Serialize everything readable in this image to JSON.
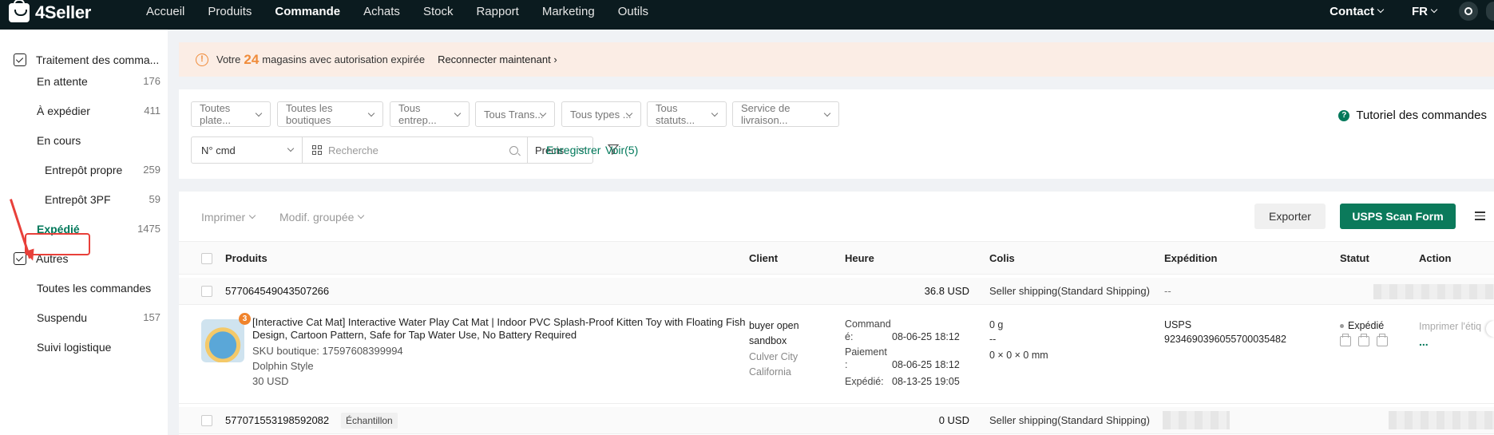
{
  "brand": {
    "name": "4Seller"
  },
  "nav": {
    "items": [
      "Accueil",
      "Produits",
      "Commande",
      "Achats",
      "Stock",
      "Rapport",
      "Marketing",
      "Outils"
    ],
    "active": "Commande",
    "contact": "Contact",
    "lang": "FR"
  },
  "sidebar": {
    "group1": "Traitement des comma...",
    "pending": {
      "label": "En attente",
      "count": "176"
    },
    "to_ship": {
      "label": "À expédier",
      "count": "411"
    },
    "in_progress": {
      "label": "En cours"
    },
    "own_wh": {
      "label": "Entrepôt propre",
      "count": "259"
    },
    "wh_3pf": {
      "label": "Entrepôt 3PF",
      "count": "59"
    },
    "shipped": {
      "label": "Expédié",
      "count": "1475"
    },
    "group2": "Autres",
    "all_orders": {
      "label": "Toutes les commandes"
    },
    "suspended": {
      "label": "Suspendu",
      "count": "157"
    },
    "tracking": {
      "label": "Suivi logistique"
    }
  },
  "alert": {
    "prefix": "Votre",
    "count": "24",
    "suffix": "magasins avec autorisation expirée",
    "action": "Reconnecter maintenant"
  },
  "filters": {
    "platforms": "Toutes plate...",
    "shops": "Toutes les boutiques",
    "warehouses": "Tous entrep...",
    "carriers": "Tous Trans...",
    "types": "Tous types ...",
    "statuses": "Tous statuts...",
    "delivery": "Service de livraison...",
    "tutorial": "Tutoriel des commandes",
    "field": "N° cmd",
    "search_placeholder": "Recherche",
    "match": "Précis",
    "save": "Enregistrer",
    "view": "Voir(5)"
  },
  "toolbar": {
    "print": "Imprimer",
    "bulk_edit": "Modif. groupée",
    "export": "Exporter",
    "usps": "USPS Scan Form"
  },
  "table": {
    "headers": [
      "Produits",
      "Client",
      "Heure",
      "Colis",
      "Expédition",
      "Statut",
      "Action"
    ],
    "order1": {
      "id": "577064549043507266",
      "amount": "36.8 USD",
      "shipping": "Seller shipping(Standard Shipping)",
      "expedition": "--",
      "product": {
        "qty_badge": "3",
        "title": "[Interactive Cat Mat] Interactive Water Play Cat Mat | Indoor PVC Splash-Proof Kitten Toy with Floating Fish Design, Cartoon Pattern, Safe for Tap Water Use, No Battery Required",
        "sku": "SKU boutique: 17597608399994",
        "variant": "Dolphin Style",
        "price": "30 USD"
      },
      "client": {
        "line1": "buyer open",
        "line2": "sandbox",
        "city": "Culver City",
        "state": "California"
      },
      "time": {
        "order_label_1": "Command",
        "order_label_2": "é:",
        "order_value": "08-06-25 18:12",
        "pay_label_1": "Paiement",
        "pay_label_2": ":",
        "pay_value": "08-06-25 18:12",
        "ship_label": "Expédié:",
        "ship_value": "08-13-25 19:05"
      },
      "colis": {
        "weight": "0 g",
        "dash": "--",
        "dims": "0 × 0 × 0 mm"
      },
      "carrier": {
        "name": "USPS",
        "tracking": "9234690396055700035482"
      },
      "status": "Expédié",
      "action_print": "Imprimer l'étiq",
      "action_more": "..."
    },
    "order2": {
      "id": "577071553198592082",
      "tag": "Échantillon",
      "amount": "0 USD",
      "shipping": "Seller shipping(Standard Shipping)"
    }
  },
  "colors": {
    "accent": "#00785a",
    "topbar": "#0b1b1f",
    "warning": "#f08c3b",
    "annotation": "#e8403a"
  }
}
